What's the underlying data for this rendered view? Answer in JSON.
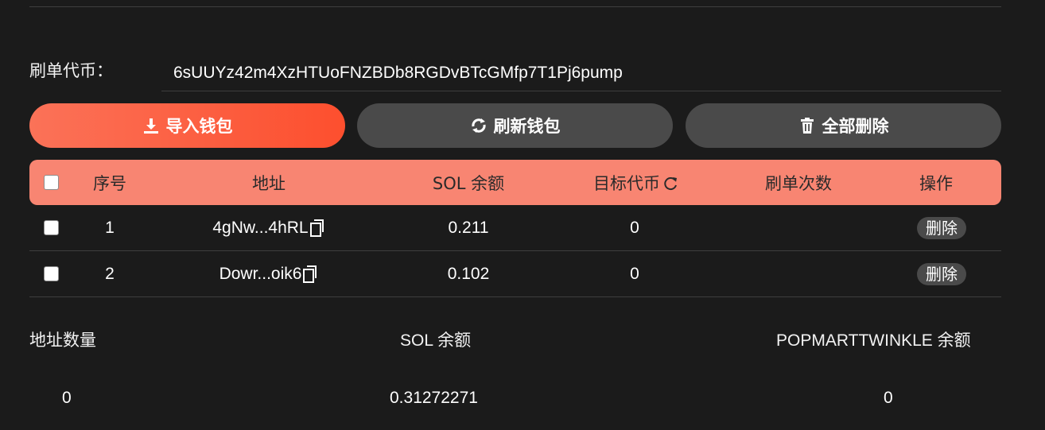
{
  "token": {
    "label": "刷单代币：",
    "value": "6sUUYz42m4XzHTUoFNZBDb8RGDvBTcGMfp7T1Pj6pump"
  },
  "buttons": {
    "import_label": "导入钱包",
    "refresh_label": "刷新钱包",
    "delete_all_label": "全部删除"
  },
  "table": {
    "columns": [
      "序号",
      "地址",
      "SOL 余额",
      "目标代币",
      "刷单次数",
      "操作"
    ],
    "rows": [
      {
        "index": "1",
        "address": "4gNw...4hRL",
        "sol": "0.211",
        "target": "0",
        "count": "",
        "action": "删除"
      },
      {
        "index": "2",
        "address": "Dowr...oik6",
        "sol": "0.102",
        "target": "0",
        "count": "",
        "action": "删除"
      }
    ]
  },
  "summary": {
    "address_count_label": "地址数量",
    "sol_balance_label": "SOL 余额",
    "token_balance_label": "POPMARTTWINKLE 余额",
    "address_count": "0",
    "sol_balance": "0.31272271",
    "token_balance": "0"
  },
  "colors": {
    "background": "#1b1b1b",
    "accent_gradient_start": "#fb7258",
    "accent_gradient_end": "#fd4f2e",
    "table_header": "#f88572",
    "secondary_button": "#4a4a4a"
  },
  "icons": {
    "import": "download-icon",
    "refresh": "refresh-icon",
    "delete_all": "trash-icon",
    "copy": "copy-icon",
    "reload": "reload-icon"
  }
}
